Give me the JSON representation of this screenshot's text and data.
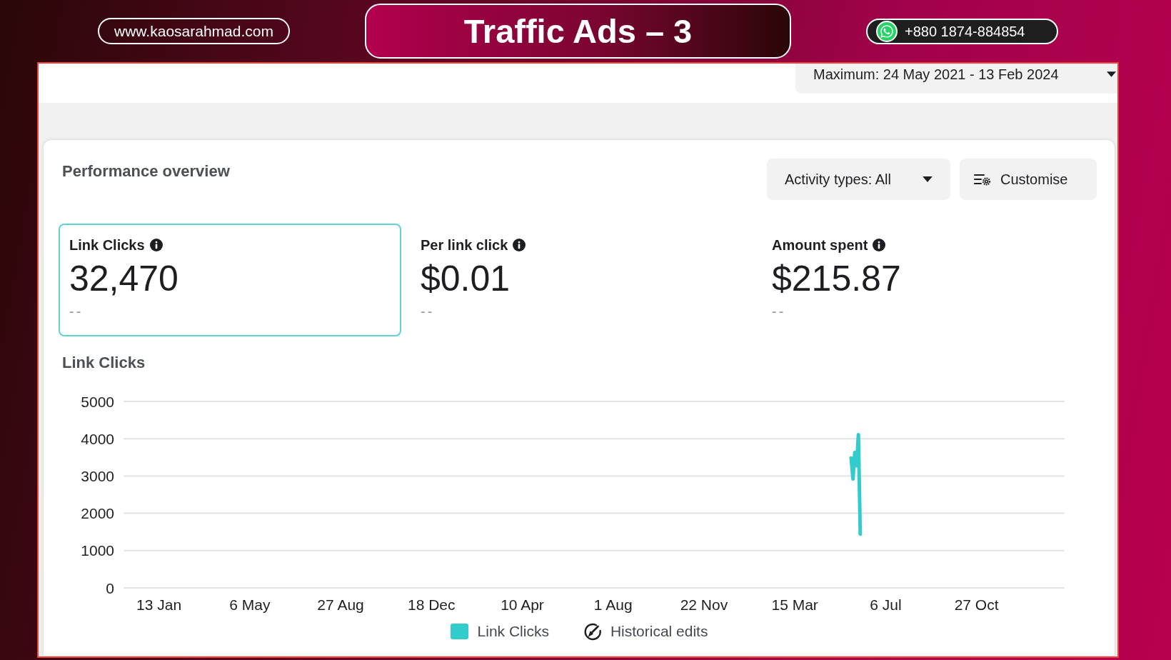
{
  "banner": {
    "website": "www.kaosarahmad.com",
    "title": "Traffic Ads – 3",
    "phone": "+880 1874-884854"
  },
  "date_range": {
    "label": "Maximum: 24 May 2021 - 13 Feb 2024"
  },
  "performance_overview": {
    "title": "Performance overview",
    "activity_filter": {
      "label": "Activity types: All"
    },
    "customise_button": {
      "label": "Customise"
    },
    "metrics": [
      {
        "label": "Link Clicks",
        "value": "32,470",
        "change": "--",
        "selected": true
      },
      {
        "label": "Per link click",
        "value": "$0.01",
        "change": "--",
        "selected": false
      },
      {
        "label": "Amount spent",
        "value": "$215.87",
        "change": "--",
        "selected": false
      }
    ],
    "chart": {
      "chart_data": {
        "type": "line",
        "title": "Link Clicks",
        "grid": true,
        "categories": [
          null,
          null,
          null,
          null,
          null,
          null,
          null,
          null,
          null,
          null,
          null,
          null,
          null,
          null,
          null,
          null,
          null,
          null,
          null,
          "13 Jan",
          null,
          null,
          null,
          null,
          null,
          null,
          null,
          null,
          null,
          null,
          null,
          null,
          null,
          null,
          null,
          null,
          null,
          null,
          null,
          null,
          null,
          null,
          null,
          null,
          null,
          null,
          null,
          null,
          null,
          null,
          null,
          null,
          null,
          null,
          null,
          null,
          null,
          null,
          null,
          null,
          null,
          null,
          null,
          null,
          null,
          null,
          null,
          null,
          null,
          "6 May",
          null,
          null,
          null,
          null,
          null,
          null,
          null,
          null,
          null,
          null,
          null,
          null,
          null,
          null,
          null,
          null,
          null,
          null,
          null,
          null,
          null,
          null,
          null,
          null,
          null,
          null,
          null,
          null,
          null,
          null,
          null,
          null,
          null,
          null,
          null,
          null,
          null,
          null,
          null,
          null,
          null,
          null,
          null,
          null,
          null,
          null,
          null,
          null,
          null,
          "27 Aug",
          null,
          null,
          null,
          null,
          null,
          null,
          null,
          null,
          null,
          null,
          null,
          null,
          null,
          null,
          null,
          null,
          null,
          null,
          null,
          null,
          null,
          null,
          null,
          null,
          null,
          null,
          null,
          null,
          null,
          null,
          null,
          null,
          null,
          null,
          null,
          null,
          null,
          null,
          null,
          null,
          null,
          null,
          null,
          null,
          null,
          null,
          null,
          null,
          null,
          "18 Dec",
          null,
          null,
          null,
          null,
          null,
          null,
          null,
          null,
          null,
          null,
          null,
          null,
          null,
          null,
          null,
          null,
          null,
          null,
          null,
          null,
          null,
          null,
          null,
          null,
          null,
          null,
          null,
          null,
          null,
          null,
          null,
          null,
          null,
          null,
          null,
          null,
          null,
          null,
          null,
          null,
          null,
          null,
          null,
          null,
          null,
          null,
          null,
          null,
          null,
          "10 Apr",
          null,
          null,
          null,
          null,
          null,
          null,
          null,
          null,
          null,
          null,
          null,
          null,
          null,
          null,
          null,
          null,
          null,
          null,
          null,
          null,
          null,
          null,
          null,
          null,
          null,
          null,
          null,
          null,
          null,
          null,
          null,
          null,
          null,
          null,
          null,
          null,
          null,
          null,
          null,
          null,
          null,
          null,
          null,
          null,
          null,
          null,
          null,
          null,
          null,
          "1 Aug",
          null,
          null,
          null,
          null,
          null,
          null,
          null,
          null,
          null,
          null,
          null,
          null,
          null,
          null,
          null,
          null,
          null,
          null,
          null,
          null,
          null,
          null,
          null,
          null,
          null,
          null,
          null,
          null,
          null,
          null,
          null,
          null,
          null,
          null,
          null,
          null,
          null,
          null,
          null,
          null,
          null,
          null,
          null,
          null,
          null,
          null,
          null,
          null,
          null,
          "22 Nov",
          null,
          null,
          null,
          null,
          null,
          null,
          null,
          null,
          null,
          null,
          null,
          null,
          null,
          null,
          null,
          null,
          null,
          null,
          null,
          null,
          null,
          null,
          null,
          null,
          null,
          null,
          null,
          null,
          null,
          null,
          null,
          null,
          null,
          null,
          null,
          null,
          null,
          null,
          null,
          null,
          null,
          null,
          null,
          null,
          null,
          null,
          null,
          null,
          null,
          "15 Mar",
          null,
          null,
          null,
          null,
          null,
          null,
          null,
          null,
          null,
          null,
          null,
          null,
          null,
          null,
          null,
          null,
          null,
          null,
          null,
          null,
          null,
          null,
          null,
          null,
          null,
          null,
          null,
          null,
          null,
          null,
          null,
          null,
          null,
          null,
          null,
          null,
          null,
          null,
          null,
          null,
          null,
          null,
          null,
          null,
          null,
          null,
          null,
          null,
          null,
          "6 Jul",
          null,
          null,
          null,
          null,
          null,
          null,
          null,
          null,
          null,
          null,
          null,
          null,
          null,
          null,
          null,
          null,
          null,
          null,
          null,
          null,
          null,
          null,
          null,
          null,
          null,
          null,
          null,
          null,
          null,
          null,
          null,
          null,
          null,
          null,
          null,
          null,
          null,
          null,
          null,
          null,
          null,
          null,
          null,
          null,
          null,
          null,
          null,
          null,
          null,
          "27 Oct",
          null,
          null,
          null,
          null,
          null,
          null,
          null,
          null,
          null,
          null,
          null,
          null,
          null,
          null,
          null,
          null,
          null,
          null,
          null,
          null,
          null,
          null,
          null,
          null,
          null,
          null,
          null,
          null,
          null,
          null,
          null,
          null,
          null,
          null,
          null,
          null,
          null,
          null,
          null,
          null,
          null,
          null,
          null,
          null,
          null,
          null,
          null,
          null
        ],
        "series": [
          {
            "name": "Link Clicks",
            "color": "#33cccc",
            "values": [
              null,
              null,
              null,
              null,
              null,
              null,
              null,
              null,
              null,
              null,
              null,
              null,
              null,
              null,
              null,
              null,
              null,
              null,
              null,
              null,
              null,
              null,
              null,
              null,
              null,
              null,
              null,
              null,
              null,
              null,
              null,
              null,
              null,
              null,
              null,
              null,
              null,
              null,
              null,
              null,
              null,
              null,
              null,
              null,
              null,
              null,
              null,
              null,
              null,
              null,
              null,
              null,
              null,
              null,
              null,
              null,
              null,
              null,
              null,
              null,
              null,
              null,
              null,
              null,
              null,
              null,
              null,
              null,
              null,
              null,
              null,
              null,
              null,
              null,
              null,
              null,
              null,
              null,
              null,
              null,
              null,
              null,
              null,
              null,
              null,
              null,
              null,
              null,
              null,
              null,
              null,
              null,
              null,
              null,
              null,
              null,
              null,
              null,
              null,
              null,
              null,
              null,
              null,
              null,
              null,
              null,
              null,
              null,
              null,
              null,
              null,
              null,
              null,
              null,
              null,
              null,
              null,
              null,
              null,
              null,
              null,
              null,
              null,
              null,
              null,
              null,
              null,
              null,
              null,
              null,
              null,
              null,
              null,
              null,
              null,
              null,
              null,
              null,
              null,
              null,
              null,
              null,
              null,
              null,
              null,
              null,
              null,
              null,
              null,
              null,
              null,
              null,
              null,
              null,
              null,
              null,
              null,
              null,
              null,
              null,
              null,
              null,
              null,
              null,
              null,
              null,
              null,
              null,
              null,
              null,
              null,
              null,
              null,
              null,
              null,
              null,
              null,
              null,
              null,
              null,
              null,
              null,
              null,
              null,
              null,
              null,
              null,
              null,
              null,
              null,
              null,
              null,
              null,
              null,
              null,
              null,
              null,
              null,
              null,
              null,
              null,
              null,
              null,
              null,
              null,
              null,
              null,
              null,
              null,
              null,
              null,
              null,
              null,
              null,
              null,
              null,
              null,
              null,
              null,
              null,
              null,
              null,
              null,
              null,
              null,
              null,
              null,
              null,
              null,
              null,
              null,
              null,
              null,
              null,
              null,
              null,
              null,
              null,
              null,
              null,
              null,
              null,
              null,
              null,
              null,
              null,
              null,
              null,
              null,
              null,
              null,
              null,
              null,
              null,
              null,
              null,
              null,
              null,
              null,
              null,
              null,
              null,
              null,
              null,
              null,
              null,
              null,
              null,
              null,
              null,
              null,
              null,
              null,
              null,
              null,
              null,
              null,
              null,
              null,
              null,
              null,
              null,
              null,
              null,
              null,
              null,
              null,
              null,
              null,
              null,
              null,
              null,
              null,
              null,
              null,
              null,
              null,
              null,
              null,
              null,
              null,
              null,
              null,
              null,
              null,
              null,
              null,
              null,
              null,
              null,
              null,
              null,
              null,
              null,
              null,
              null,
              null,
              null,
              null,
              null,
              null,
              null,
              null,
              null,
              null,
              null,
              null,
              null,
              null,
              null,
              null,
              null,
              null,
              null,
              null,
              null,
              null,
              null,
              null,
              null,
              null,
              null,
              null,
              null,
              null,
              null,
              null,
              null,
              null,
              null,
              null,
              null,
              null,
              null,
              null,
              null,
              null,
              null,
              null,
              null,
              null,
              null,
              null,
              null,
              null,
              null,
              null,
              null,
              null,
              null,
              null,
              null,
              null,
              null,
              null,
              null,
              null,
              null,
              null,
              null,
              null,
              null,
              null,
              null,
              null,
              null,
              null,
              null,
              null,
              null,
              null,
              null,
              null,
              null,
              null,
              null,
              null,
              null,
              null,
              null,
              3480,
              2920,
              3630,
              3280,
              4110,
              1440,
              null,
              null,
              null,
              null,
              null,
              null,
              null,
              null,
              null,
              null,
              null,
              null,
              null,
              null,
              null,
              null,
              null,
              null,
              null,
              null,
              null,
              null,
              null,
              null,
              null,
              null,
              null,
              null,
              null,
              null,
              null,
              null,
              null,
              null,
              null,
              null,
              null,
              null,
              null,
              null,
              null,
              null,
              null,
              null,
              null,
              null,
              null,
              null,
              null,
              null,
              null,
              null,
              null,
              null,
              null,
              null,
              null,
              null,
              null,
              null,
              null,
              null,
              null,
              null,
              null,
              null,
              null,
              null,
              null,
              null,
              null,
              null,
              null,
              null,
              null,
              null,
              null,
              null,
              null,
              null,
              null,
              null,
              null,
              null,
              null,
              null,
              null,
              null,
              null,
              null,
              null,
              null,
              null,
              null,
              null,
              null,
              null,
              null,
              null,
              null,
              null,
              null,
              null,
              null,
              null,
              null,
              null,
              null,
              null,
              null,
              null,
              null
            ]
          }
        ],
        "ylim": [
          0,
          5000
        ],
        "yticks": [
          0,
          1000,
          2000,
          3000,
          4000,
          5000
        ]
      },
      "historical_edits": {
        "label": "Historical edits"
      }
    }
  }
}
